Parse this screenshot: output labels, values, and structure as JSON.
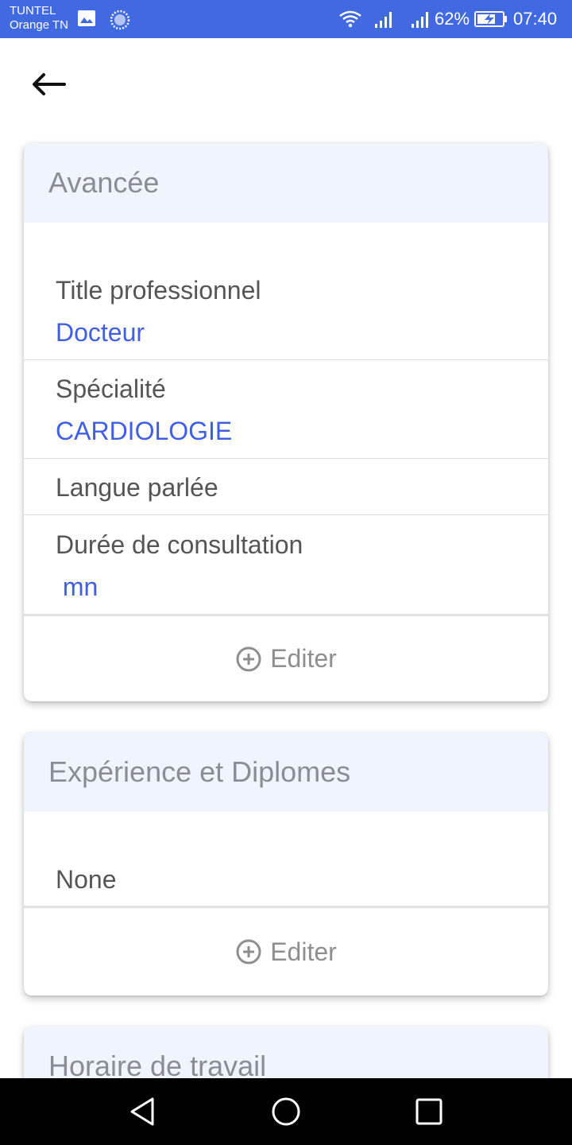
{
  "status_bar": {
    "carrier_line1": "TUNTEL",
    "carrier_line2": "Orange TN",
    "battery_pct": "62%",
    "time": "07:40",
    "icons": [
      "image-icon",
      "sync-icon",
      "wifi-icon",
      "signal-icon",
      "signal-icon",
      "battery-charging-icon"
    ]
  },
  "header": {
    "back_icon": "arrow-left-icon"
  },
  "avancee": {
    "title": "Avancée",
    "rows": [
      {
        "label": "Title professionnel",
        "value": "Docteur"
      },
      {
        "label": "Spécialité",
        "value": "CARDIOLOGIE"
      },
      {
        "label": "Langue parlée"
      },
      {
        "label": "Durée de consultation",
        "value": " mn"
      }
    ],
    "edit_label": "Editer"
  },
  "experience": {
    "title": "Expérience et Diplomes",
    "items": [
      "None"
    ],
    "edit_label": "Editer"
  },
  "horaire": {
    "title": "Horaire de travail"
  },
  "nav_bar": {
    "icons": [
      "back-triangle-icon",
      "home-circle-icon",
      "recents-square-icon"
    ]
  },
  "colors": {
    "status_bar": "#4169e1",
    "value_text": "#3f5fe0",
    "card_header": "#f0f4fd"
  }
}
